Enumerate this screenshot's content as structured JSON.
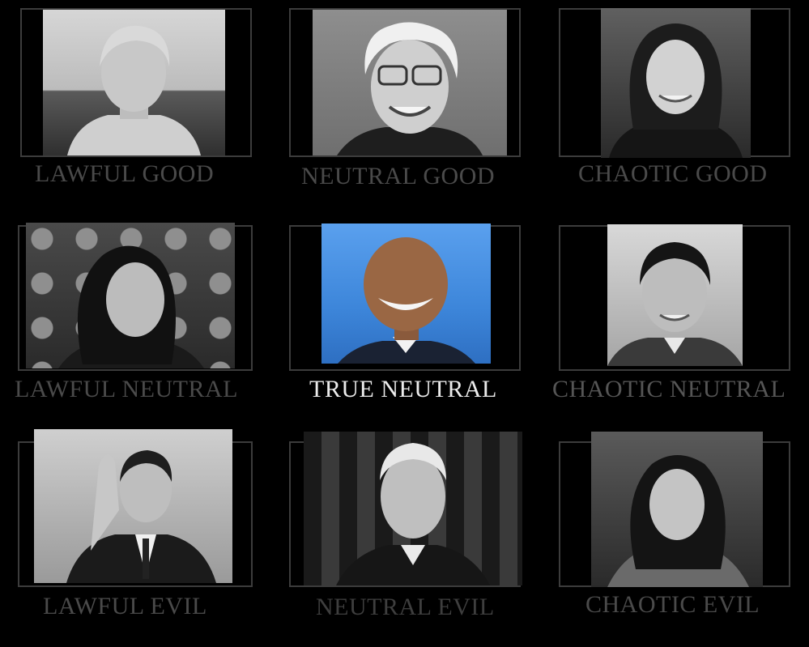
{
  "alignments": [
    {
      "label": "LAWFUL GOOD",
      "photo": "portrait-photo"
    },
    {
      "label": "NEUTRAL GOOD",
      "photo": "portrait-photo"
    },
    {
      "label": "CHAOTIC GOOD",
      "photo": "portrait-photo"
    },
    {
      "label": "LAWFUL NEUTRAL",
      "photo": "portrait-photo"
    },
    {
      "label": "TRUE NEUTRAL",
      "photo": "portrait-photo-color"
    },
    {
      "label": "CHAOTIC NEUTRAL",
      "photo": "portrait-photo"
    },
    {
      "label": "LAWFUL EVIL",
      "photo": "portrait-photo"
    },
    {
      "label": "NEUTRAL EVIL",
      "photo": "portrait-photo"
    },
    {
      "label": "CHAOTIC EVIL",
      "photo": "portrait-photo"
    }
  ],
  "colors": {
    "background": "#000000",
    "label_dim": "#4a4a4a",
    "label_highlight": "#ececec",
    "frame": "#3c3c3c",
    "highlight_sky": "#3d86da"
  }
}
